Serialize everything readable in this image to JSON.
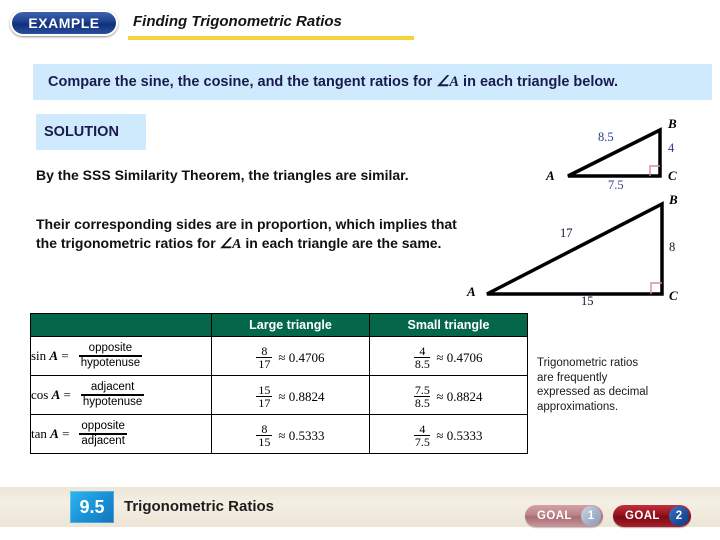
{
  "header": {
    "badge_label": "EXAMPLE",
    "title": "Finding Trigonometric Ratios",
    "rule_color": "#f2d43c"
  },
  "prompt": {
    "text_before": "Compare the sine, the cosine, and the tangent ratios for ",
    "angle_symbol": "∠A",
    "text_after": " in each triangle below.",
    "background": "#cfeafc",
    "text_color": "#1a1a50"
  },
  "solution": {
    "label": "SOLUTION",
    "background": "#cfeafc"
  },
  "body": {
    "paragraph_1": "By the SSS Similarity Theorem, the triangles are similar.",
    "paragraph_2_line_1": "Their corresponding sides are in proportion, which implies that",
    "paragraph_2_line_2_before": "the trigonometric ratios for ",
    "paragraph_2_angle": "∠A",
    "paragraph_2_line_2_after": " in each triangle are the same."
  },
  "triangles": [
    {
      "name": "small-triangle",
      "vertices": {
        "a": "A",
        "b": "B",
        "c": "C"
      },
      "sides": {
        "hypotenuse": "8.5",
        "opposite": "4",
        "adjacent": "7.5"
      },
      "label_color": "#2b3f8a",
      "right_angle_color": "#d48d9e"
    },
    {
      "name": "large-triangle",
      "vertices": {
        "a": "A",
        "b": "B",
        "c": "C"
      },
      "sides": {
        "hypotenuse": "17",
        "opposite": "8",
        "adjacent": "15"
      },
      "label_color": "#14142e",
      "right_angle_color": "#d48d9e"
    }
  ],
  "table": {
    "header_color": "#05674a",
    "columns": [
      "",
      "Large triangle",
      "Small triangle"
    ],
    "rows": [
      {
        "fn_prefix": "sin ",
        "fn_var": "A",
        "fn_eq": " =",
        "ratio_num": "opposite",
        "ratio_den": "hypotenuse",
        "large": {
          "num": "8",
          "den": "17",
          "approx": "≈ 0.4706"
        },
        "small": {
          "num": "4",
          "den": "8.5",
          "approx": "≈ 0.4706"
        }
      },
      {
        "fn_prefix": "cos ",
        "fn_var": "A",
        "fn_eq": " =",
        "ratio_num": "adjacent",
        "ratio_den": "hypotenuse",
        "large": {
          "num": "15",
          "den": "17",
          "approx": "≈ 0.8824"
        },
        "small": {
          "num": "7.5",
          "den": "8.5",
          "approx": "≈ 0.8824"
        }
      },
      {
        "fn_prefix": "tan ",
        "fn_var": "A",
        "fn_eq": " =",
        "ratio_num": "opposite",
        "ratio_den": "adjacent",
        "large": {
          "num": "8",
          "den": "15",
          "approx": "≈ 0.5333"
        },
        "small": {
          "num": "4",
          "den": "7.5",
          "approx": "≈ 0.5333"
        }
      }
    ]
  },
  "side_note": {
    "line_1": "Trigonometric ratios",
    "line_2": "are frequently",
    "line_3": "expressed as decimal",
    "line_4": "approximations."
  },
  "footer": {
    "section_number": "9.5",
    "title": "Trigonometric Ratios",
    "goals": [
      {
        "label": "GOAL",
        "number": "1",
        "state": "inactive"
      },
      {
        "label": "GOAL",
        "number": "2",
        "state": "active"
      }
    ]
  }
}
